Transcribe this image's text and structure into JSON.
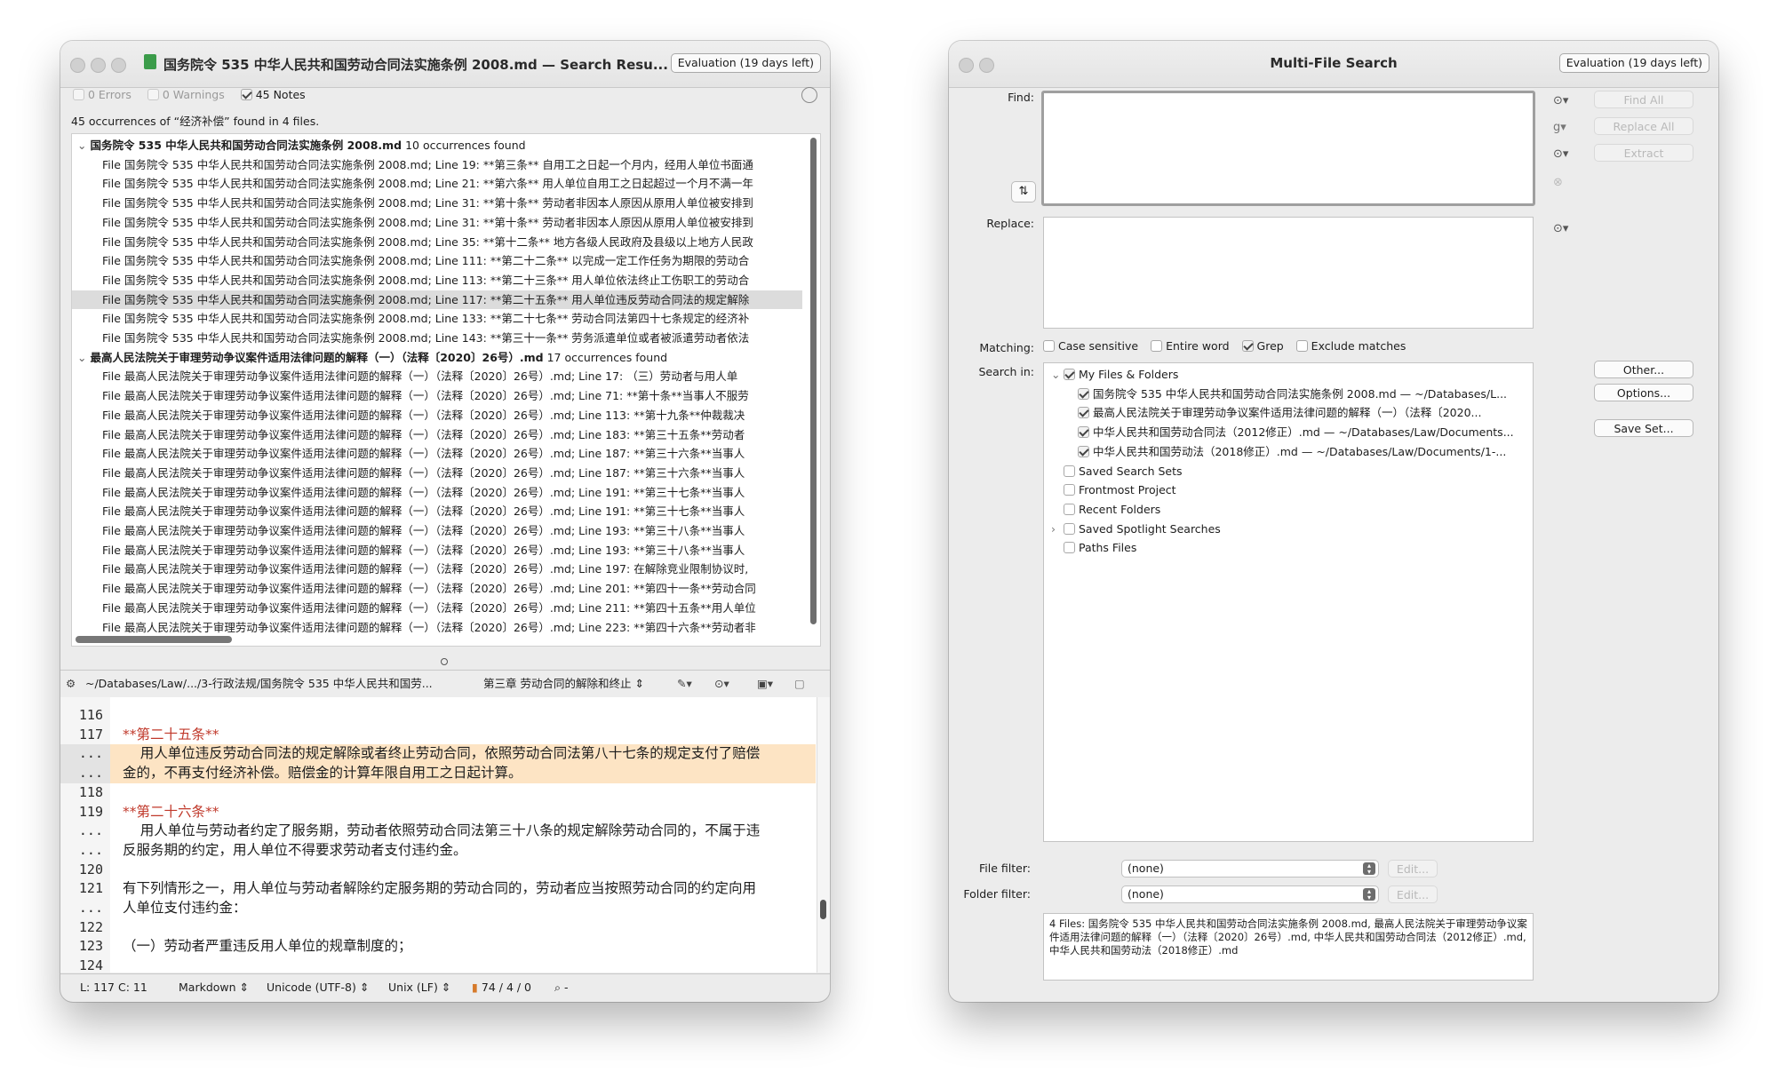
{
  "left_window": {
    "title": "国务院令 535 中华人民共和国劳动合同法实施条例 2008.md — Search Resu...",
    "eval_badge": "Evaluation (19 days left)",
    "filters": {
      "errors": "0 Errors",
      "warnings": "0 Warnings",
      "notes": "45 Notes"
    },
    "summary": "45 occurrences of “经济补偿” found in 4 files.",
    "groups": [
      {
        "title": "国务院令 535 中华人民共和国劳动合同法实施条例 2008.md",
        "count": "10 occurrences found",
        "rows": [
          "File 国务院令 535 中华人民共和国劳动合同法实施条例 2008.md; Line 19: **第三条**   自用工之日起一个月内，经用人单位书面通",
          "File 国务院令 535 中华人民共和国劳动合同法实施条例 2008.md; Line 21: **第六条**   用人单位自用工之日起超过一个月不满一年",
          "File 国务院令 535 中华人民共和国劳动合同法实施条例 2008.md; Line 31: **第十条**   劳动者非因本人原因从原用人单位被安排到",
          "File 国务院令 535 中华人民共和国劳动合同法实施条例 2008.md; Line 31: **第十条**   劳动者非因本人原因从原用人单位被安排到",
          "File 国务院令 535 中华人民共和国劳动合同法实施条例 2008.md; Line 35: **第十二条**   地方各级人民政府及县级以上地方人民政",
          "File 国务院令 535 中华人民共和国劳动合同法实施条例 2008.md; Line 111: **第二十二条**   以完成一定工作任务为期限的劳动合",
          "File 国务院令 535 中华人民共和国劳动合同法实施条例 2008.md; Line 113: **第二十三条**   用人单位依法终止工伤职工的劳动合",
          "File 国务院令 535 中华人民共和国劳动合同法实施条例 2008.md; Line 117: **第二十五条**   用人单位违反劳动合同法的规定解除",
          "File 国务院令 535 中华人民共和国劳动合同法实施条例 2008.md; Line 133: **第二十七条**   劳动合同法第四十七条规定的经济补",
          "File 国务院令 535 中华人民共和国劳动合同法实施条例 2008.md; Line 143: **第三十一条**   劳务派遣单位或者被派遣劳动者依法"
        ]
      },
      {
        "title": "最高人民法院关于审理劳动争议案件适用法律问题的解释（一）（法释〔2020〕26号）.md",
        "count": "17 occurrences found",
        "rows": [
          "File 最高人民法院关于审理劳动争议案件适用法律问题的解释（一）（法释〔2020〕26号）.md; Line 17: （三）劳动者与用人单",
          "File 最高人民法院关于审理劳动争议案件适用法律问题的解释（一）（法释〔2020〕26号）.md; Line 71: **第十条**当事人不服劳",
          "File 最高人民法院关于审理劳动争议案件适用法律问题的解释（一）（法释〔2020〕26号）.md; Line 113: **第十九条**仲裁裁决",
          "File 最高人民法院关于审理劳动争议案件适用法律问题的解释（一）（法释〔2020〕26号）.md; Line 183: **第三十五条**劳动者",
          "File 最高人民法院关于审理劳动争议案件适用法律问题的解释（一）（法释〔2020〕26号）.md; Line 187: **第三十六条**当事人",
          "File 最高人民法院关于审理劳动争议案件适用法律问题的解释（一）（法释〔2020〕26号）.md; Line 187: **第三十六条**当事人",
          "File 最高人民法院关于审理劳动争议案件适用法律问题的解释（一）（法释〔2020〕26号）.md; Line 191: **第三十七条**当事人",
          "File 最高人民法院关于审理劳动争议案件适用法律问题的解释（一）（法释〔2020〕26号）.md; Line 191: **第三十七条**当事人",
          "File 最高人民法院关于审理劳动争议案件适用法律问题的解释（一）（法释〔2020〕26号）.md; Line 193: **第三十八条**当事人",
          "File 最高人民法院关于审理劳动争议案件适用法律问题的解释（一）（法释〔2020〕26号）.md; Line 193: **第三十八条**当事人",
          "File 最高人民法院关于审理劳动争议案件适用法律问题的解释（一）（法释〔2020〕26号）.md; Line 197: 在解除竞业限制协议时,",
          "File 最高人民法院关于审理劳动争议案件适用法律问题的解释（一）（法释〔2020〕26号）.md; Line 201: **第四十一条**劳动合同",
          "File 最高人民法院关于审理劳动争议案件适用法律问题的解释（一）（法释〔2020〕26号）.md; Line 211: **第四十五条**用人单位",
          "File 最高人民法院关于审理劳动争议案件适用法律问题的解释（一）（法释〔2020〕26号）.md; Line 223: **第四十六条**劳动者非"
        ]
      }
    ],
    "editor_toolbar": {
      "path": "~/Databases/Law/.../3-行政法规/国务院令 535 中华人民共和国劳...",
      "section": "第三章   劳动合同的解除和终止"
    },
    "editor_lines": [
      {
        "num": "116",
        "text": "",
        "style": "plain"
      },
      {
        "num": "117",
        "text": "**第二十五条**",
        "style": "heading"
      },
      {
        "num": "...",
        "text": "    用人单位违反劳动合同法的规定解除或者终止劳动合同，依照劳动合同法第八十七条的规定支付了赔偿",
        "style": "highlight"
      },
      {
        "num": "...",
        "text": "金的，不再支付经济补偿。赔偿金的计算年限自用工之日起计算。",
        "style": "highlight"
      },
      {
        "num": "118",
        "text": "",
        "style": "plain"
      },
      {
        "num": "119",
        "text": "**第二十六条**",
        "style": "heading"
      },
      {
        "num": "...",
        "text": "    用人单位与劳动者约定了服务期，劳动者依照劳动合同法第三十八条的规定解除劳动合同的，不属于违",
        "style": "plain"
      },
      {
        "num": "...",
        "text": "反服务期的约定，用人单位不得要求劳动者支付违约金。",
        "style": "plain"
      },
      {
        "num": "120",
        "text": "",
        "style": "plain"
      },
      {
        "num": "121",
        "text": "有下列情形之一，用人单位与劳动者解除约定服务期的劳动合同的，劳动者应当按照劳动合同的约定向用",
        "style": "plain"
      },
      {
        "num": "...",
        "text": "人单位支付违约金：",
        "style": "plain"
      },
      {
        "num": "122",
        "text": "",
        "style": "plain"
      },
      {
        "num": "123",
        "text": "（一）劳动者严重违反用人单位的规章制度的；",
        "style": "plain"
      },
      {
        "num": "124",
        "text": "",
        "style": "plain"
      }
    ],
    "statusbar": {
      "position": "L: 117 C: 11",
      "language": "Markdown",
      "encoding": "Unicode (UTF-8)",
      "line_endings": "Unix (LF)",
      "counts": "74 / 4 / 0",
      "search": "-"
    }
  },
  "right_window": {
    "title": "Multi-File Search",
    "eval_badge": "Evaluation (19 days left)",
    "find_label": "Find:",
    "replace_label": "Replace:",
    "find_value": "",
    "replace_value": "",
    "buttons": {
      "find_all": "Find All",
      "replace_all": "Replace All",
      "extract": "Extract",
      "other": "Other...",
      "options": "Options...",
      "save_set": "Save Set..."
    },
    "matching_label": "Matching:",
    "matching": [
      {
        "label": "Case sensitive",
        "checked": false
      },
      {
        "label": "Entire word",
        "checked": false
      },
      {
        "label": "Grep",
        "checked": true
      },
      {
        "label": "Exclude matches",
        "checked": false
      }
    ],
    "search_in_label": "Search in:",
    "tree": {
      "root": "My Files & Folders",
      "files": [
        "国务院令 535 中华人民共和国劳动合同法实施条例 2008.md — ~/Databases/L...",
        "最高人民法院关于审理劳动争议案件适用法律问题的解释（一）（法释〔2020...",
        "中华人民共和国劳动合同法（2012修正）.md — ~/Databases/Law/Documents...",
        "中华人民共和国劳动法（2018修正）.md — ~/Databases/Law/Documents/1-..."
      ],
      "others": [
        "Saved Search Sets",
        "Frontmost Project",
        "Recent Folders",
        "Saved Spotlight Searches",
        "Paths Files"
      ]
    },
    "file_filter_label": "File filter:",
    "file_filter_value": "(none)",
    "folder_filter_label": "Folder filter:",
    "folder_filter_value": "(none)",
    "edit_label": "Edit...",
    "summary": "4 Files: 国务院令 535 中华人民共和国劳动合同法实施条例 2008.md, 最高人民法院关于审理劳动争议案件适用法律问题的解释（一）（法释〔2020〕26号）.md, 中华人民共和国劳动合同法（2012修正）.md, 中华人民共和国劳动法（2018修正）.md"
  },
  "colors": {
    "window_bg": "#ececec",
    "selection": "#dcdcdc",
    "highlight": "#fde4c4",
    "heading_red": "#c0392b",
    "match_orange": "#d2691e"
  }
}
